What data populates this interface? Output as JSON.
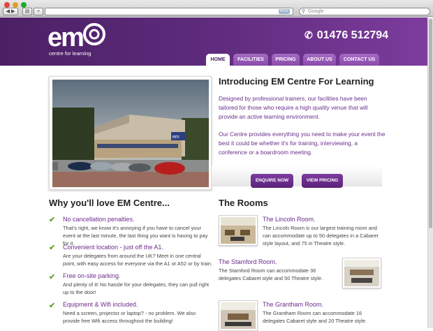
{
  "browser": {
    "search_placeholder": "Google",
    "rss_label": "RSS",
    "colors": {
      "chrome": "#d6d6d6"
    }
  },
  "brand": {
    "logo_text": "em",
    "logo_sub": "centre for learning",
    "phone": "01476 512794",
    "colors": {
      "header_dark": "#4b2064",
      "header_light": "#7c3c9c",
      "accent_text": "#6a2d8c",
      "tick_green": "#6ea233"
    }
  },
  "nav": {
    "tabs": [
      {
        "label": "HOME",
        "active": true
      },
      {
        "label": "FACILITIES",
        "active": false
      },
      {
        "label": "PRICING",
        "active": false
      },
      {
        "label": "ABOUT US",
        "active": false
      },
      {
        "label": "CONTACT US",
        "active": false
      }
    ]
  },
  "hero": {
    "title": "Introducing EM Centre For Learning",
    "para1": "Designed by professional trainers, our facilities have been tailored for those who require a high quality venue that will provide an active learning environment.",
    "para2": "Our Centre provides everything you need to make your event the best it could be whether it's for training, interviewing, a conference or a boardroom meeting.",
    "enquire_label": "ENQUIRE NOW",
    "pricing_label": "VIEW PRICING",
    "building_sign": "em"
  },
  "why": {
    "heading": "Why you'll love EM Centre...",
    "items": [
      {
        "title": "No cancellation penalties.",
        "desc": "That's right, we know it's annoying if you have to cancel your event at the last minute, the last thing you want is having to pay for it."
      },
      {
        "title": "Convenient location - just off the A1.",
        "desc": "Are your delegates from around the UK? Meet in one central point, with easy access for everyone via the A1 or A52 or by train."
      },
      {
        "title": "Free on-site parking.",
        "desc": "And plenty of it! No hassle for your delegates, they can pull right up to the door!"
      },
      {
        "title": "Equipment & Wifi included.",
        "desc": "Need a screen, projector or laptop? - no problem. We also provide free Wifi access throughout the building!"
      }
    ]
  },
  "rooms": {
    "heading": "The Rooms",
    "items": [
      {
        "title": "The Lincoln Room.",
        "desc": "The Lincoln Room is our largest training room and can accommodate up to 50 delegates in a Cabaret style layout, and 75 in Theatre style."
      },
      {
        "title": "The Stamford Room.",
        "desc": "The Stamford Room can accommodate 36 delegates Cabaret style and 50 Theatre style."
      },
      {
        "title": "The Grantham Room.",
        "desc": "The Grantham Room can accommodate 16 delegates Cabaret style and 20 Theatre style."
      }
    ]
  }
}
